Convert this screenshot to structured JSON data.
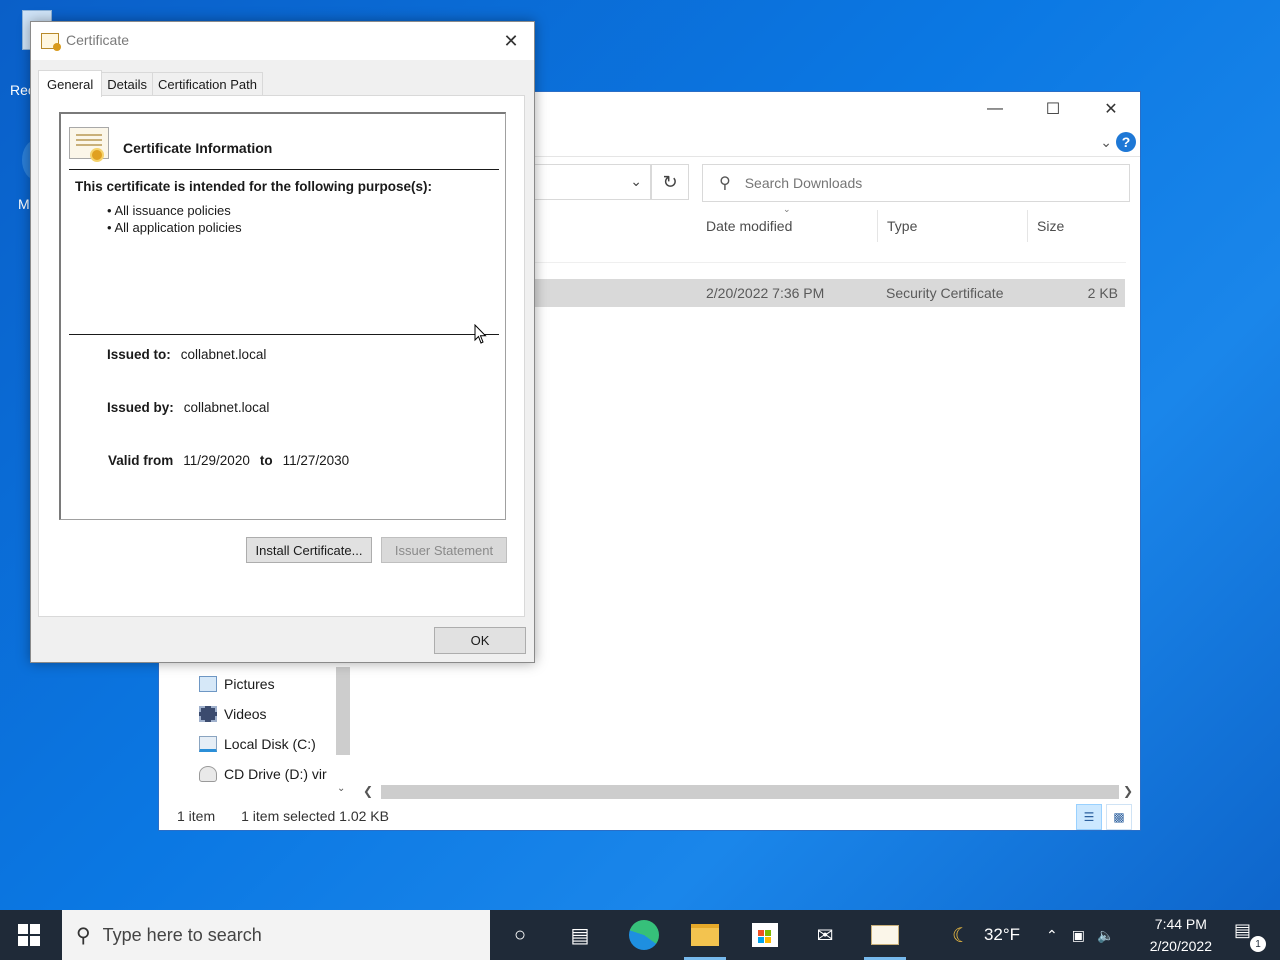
{
  "desktop": {
    "icons": [
      {
        "label": "Rec"
      },
      {
        "label": "M"
      }
    ]
  },
  "explorer": {
    "search_placeholder": "Search Downloads",
    "columns": [
      "Date modified",
      "Type",
      "Size"
    ],
    "file": {
      "date_modified": "2/20/2022 7:36 PM",
      "type": "Security Certificate",
      "size": "2 KB"
    },
    "nav_items": [
      "Pictures",
      "Videos",
      "Local Disk (C:)",
      "CD Drive (D:) vir"
    ],
    "status": {
      "count": "1 item",
      "selected": "1 item selected  1.02 KB"
    }
  },
  "certificate": {
    "window_title": "Certificate",
    "tabs": [
      "General",
      "Details",
      "Certification Path"
    ],
    "info_title": "Certificate Information",
    "purpose_heading": "This certificate is intended for the following purpose(s):",
    "purposes": [
      "All issuance policies",
      "All application policies"
    ],
    "issued_to_label": "Issued to:",
    "issued_to": "collabnet.local",
    "issued_by_label": "Issued by:",
    "issued_by": "collabnet.local",
    "valid_from_label": "Valid from",
    "valid_from": "11/29/2020",
    "to_label": "to",
    "valid_to": "11/27/2030",
    "install_button": "Install Certificate...",
    "issuer_statement_button": "Issuer Statement",
    "ok_button": "OK"
  },
  "taskbar": {
    "search_placeholder": "Type here to search",
    "weather": "32°F",
    "time": "7:44 PM",
    "date": "2/20/2022",
    "notification_count": "1"
  }
}
